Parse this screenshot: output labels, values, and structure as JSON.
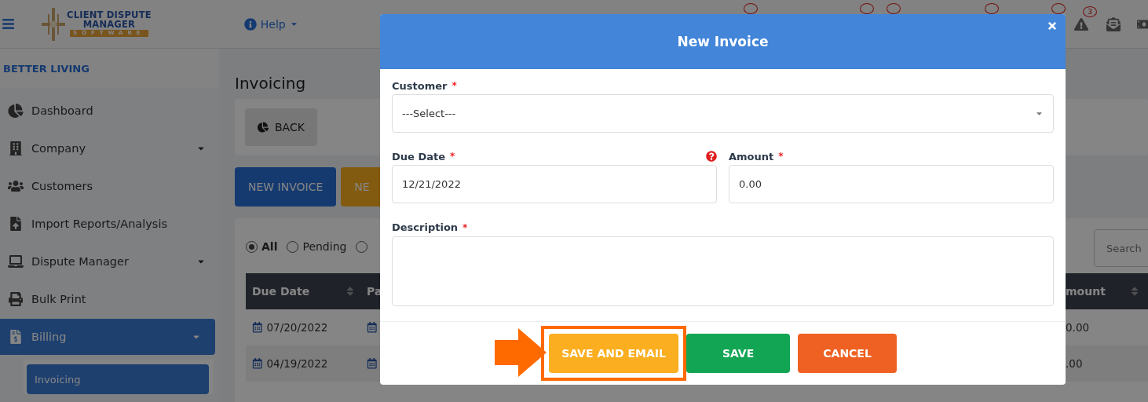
{
  "header": {
    "logo": {
      "line_1": "CLIENT DISPUTE",
      "line_2": "MANAGER",
      "line_3": "SOFTWARE"
    },
    "help": "Help",
    "partial_badges": [
      {
        "kind": "cut"
      },
      {
        "kind": "cut"
      },
      {
        "kind": "cut"
      },
      {
        "kind": "cut"
      },
      {
        "kind": "cut"
      }
    ],
    "alert_badge": "3"
  },
  "sidebar": {
    "account": "BETTER LIVING",
    "items": [
      {
        "label": "Dashboard",
        "expandable": false,
        "selected": false
      },
      {
        "label": "Company",
        "expandable": true,
        "selected": false
      },
      {
        "label": "Customers",
        "expandable": false,
        "selected": false
      },
      {
        "label": "Import Reports/Analysis",
        "expandable": false,
        "selected": false
      },
      {
        "label": "Dispute Manager",
        "expandable": true,
        "selected": false
      },
      {
        "label": "Bulk Print",
        "expandable": false,
        "selected": false
      },
      {
        "label": "Billing",
        "expandable": true,
        "selected": true,
        "children": [
          {
            "label": "Invoicing",
            "selected": true
          }
        ]
      }
    ]
  },
  "main": {
    "title": "Invoicing",
    "back_button": "BACK",
    "action_buttons": [
      {
        "label": "NEW INVOICE",
        "kind": "primary"
      },
      {
        "label": "NE",
        "kind": "warning"
      }
    ],
    "filters": [
      {
        "label": "All",
        "selected": true
      },
      {
        "label": "Pending",
        "selected": false
      },
      {
        "selected": false
      }
    ],
    "search": {
      "placeholder": "Search"
    },
    "table": {
      "columns": [
        "Due Date",
        "Pa"
      ],
      "amount_column": "mount",
      "rows": [
        {
          "due_date": "07/20/2022",
          "amount": "0.00"
        },
        {
          "due_date": "04/19/2022",
          "amount": ".00"
        }
      ]
    }
  },
  "modal": {
    "title": "New Invoice",
    "fields": [
      {
        "kind": "select",
        "label": "Customer",
        "required_mark": "*",
        "value": "---Select---"
      },
      {
        "kind": "text",
        "label": "Due Date",
        "required_mark": "*",
        "value": "12/21/2022",
        "help": true
      },
      {
        "kind": "text",
        "label": "Amount",
        "required_mark": "*",
        "value": "0.00",
        "help": false
      },
      {
        "kind": "textarea",
        "label": "Description",
        "required_mark": "*"
      }
    ],
    "buttons": [
      {
        "label": "SAVE AND EMAIL",
        "kind": "warning",
        "highlighted": true
      },
      {
        "label": "SAVE",
        "kind": "success",
        "highlighted": false
      },
      {
        "label": "CANCEL",
        "kind": "danger",
        "highlighted": false
      }
    ]
  }
}
